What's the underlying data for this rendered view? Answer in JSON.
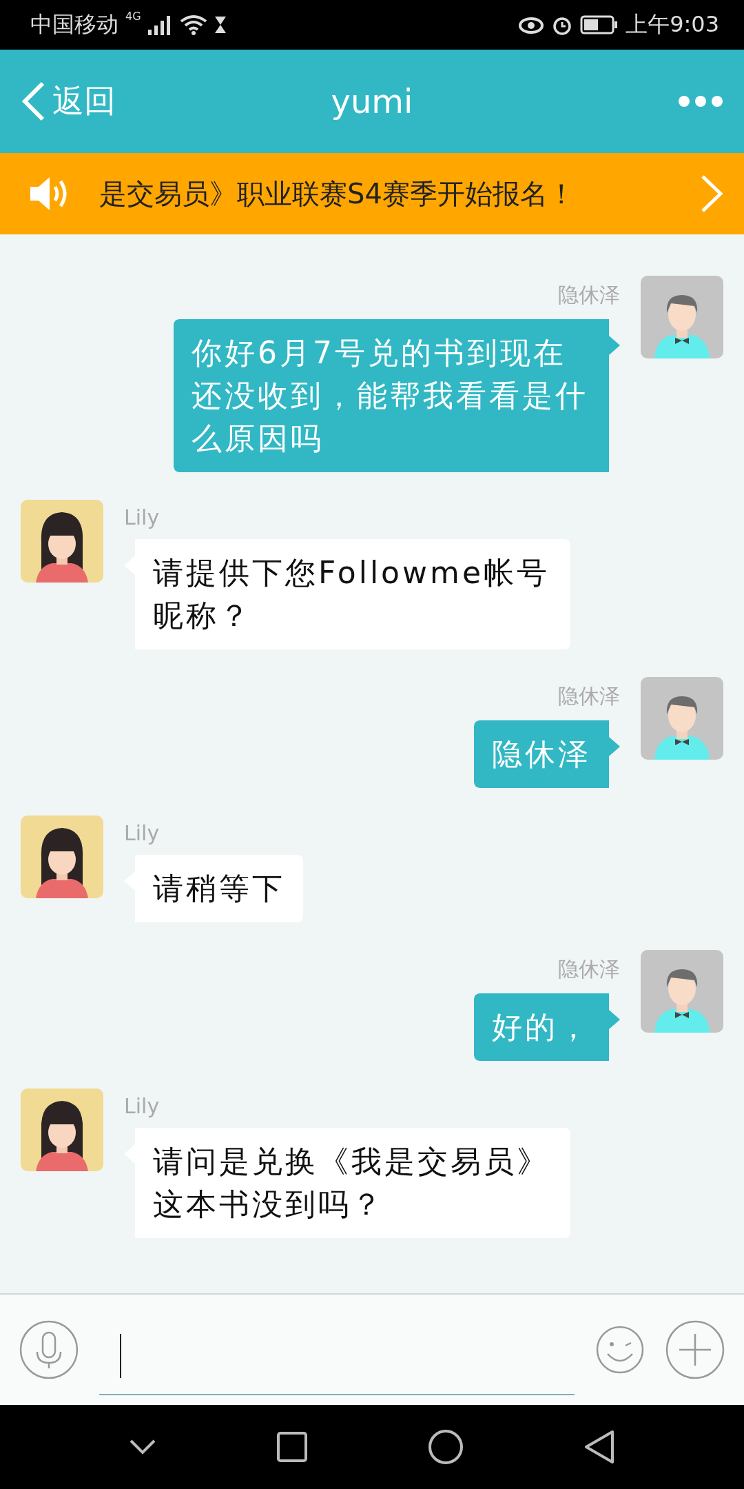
{
  "status_bar": {
    "carrier": "中国移动",
    "network": "4G",
    "time": "上午9:03"
  },
  "header": {
    "back_label": "返回",
    "title": "yumi"
  },
  "banner": {
    "text": "是交易员》职业联赛S4赛季开始报名！"
  },
  "messages": [
    {
      "kind": "sent",
      "sender": "隐休泽",
      "text": "你好6月7号兑的书到现在还没收到，能帮我看看是什么原因吗"
    },
    {
      "kind": "received",
      "sender": "Lily",
      "text": "请提供下您Followme帐号昵称？"
    },
    {
      "kind": "sent",
      "sender": "隐休泽",
      "text": "隐休泽"
    },
    {
      "kind": "received",
      "sender": "Lily",
      "text": "请稍等下"
    },
    {
      "kind": "sent",
      "sender": "隐休泽",
      "text": "好的，"
    },
    {
      "kind": "received",
      "sender": "Lily",
      "text": "请问是兑换《我是交易员》这本书没到吗？"
    }
  ]
}
